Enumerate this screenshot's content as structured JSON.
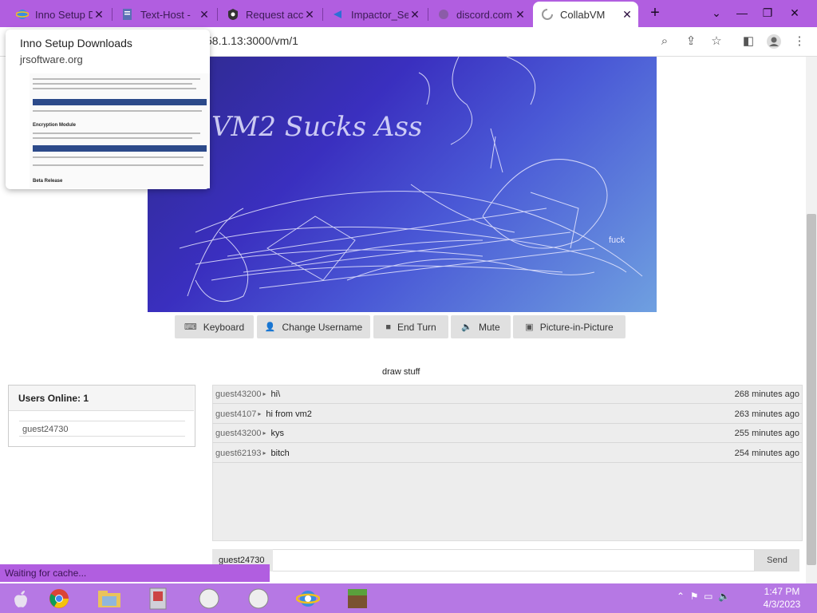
{
  "browser": {
    "tabs": [
      {
        "label": "Inno Setup D",
        "close": "✕"
      },
      {
        "label": "Text-Host - ",
        "close": "✕"
      },
      {
        "label": "Request acc",
        "close": "✕"
      },
      {
        "label": "Impactor_Se",
        "close": "✕"
      },
      {
        "label": "discord.com",
        "close": "✕"
      },
      {
        "label": "CollabVM",
        "close": "✕"
      }
    ],
    "new_tab": "+",
    "url": "58.1.13:3000/vm/1"
  },
  "tooltip": {
    "title": "Inno Setup Downloads",
    "url": "jrsoftware.org",
    "preview_headings": [
      "Encryption Module",
      "Beta Release"
    ]
  },
  "vm": {
    "screen_text_1": "VM2 Sucks Ass",
    "screen_text_2": "fuck",
    "buttons": [
      {
        "label": "Keyboard",
        "icon": "keyboard-icon"
      },
      {
        "label": "Change Username",
        "icon": "user-icon"
      },
      {
        "label": "End Turn",
        "icon": "stop-icon"
      },
      {
        "label": "Mute",
        "icon": "speaker-icon"
      },
      {
        "label": "Picture-in-Picture",
        "icon": "pip-icon"
      }
    ],
    "motd": "draw stuff"
  },
  "users": {
    "heading": "Users Online: 1",
    "list": [
      "guest24730"
    ]
  },
  "chat": {
    "messages": [
      {
        "user": "guest43200",
        "text": "hi\\",
        "time": "268 minutes ago"
      },
      {
        "user": "guest4107",
        "text": "hi from vm2",
        "time": "263 minutes ago"
      },
      {
        "user": "guest43200",
        "text": "kys",
        "time": "255 minutes ago"
      },
      {
        "user": "guest62193",
        "text": "bitch",
        "time": "254 minutes ago"
      }
    ],
    "username": "guest24730",
    "send_label": "Send"
  },
  "status": "Waiting for cache...",
  "taskbar": {
    "time": "1:47 PM",
    "date": "4/3/2023"
  },
  "colors": {
    "tabbar": "#b15ee0",
    "taskbar": "#b678e4"
  }
}
